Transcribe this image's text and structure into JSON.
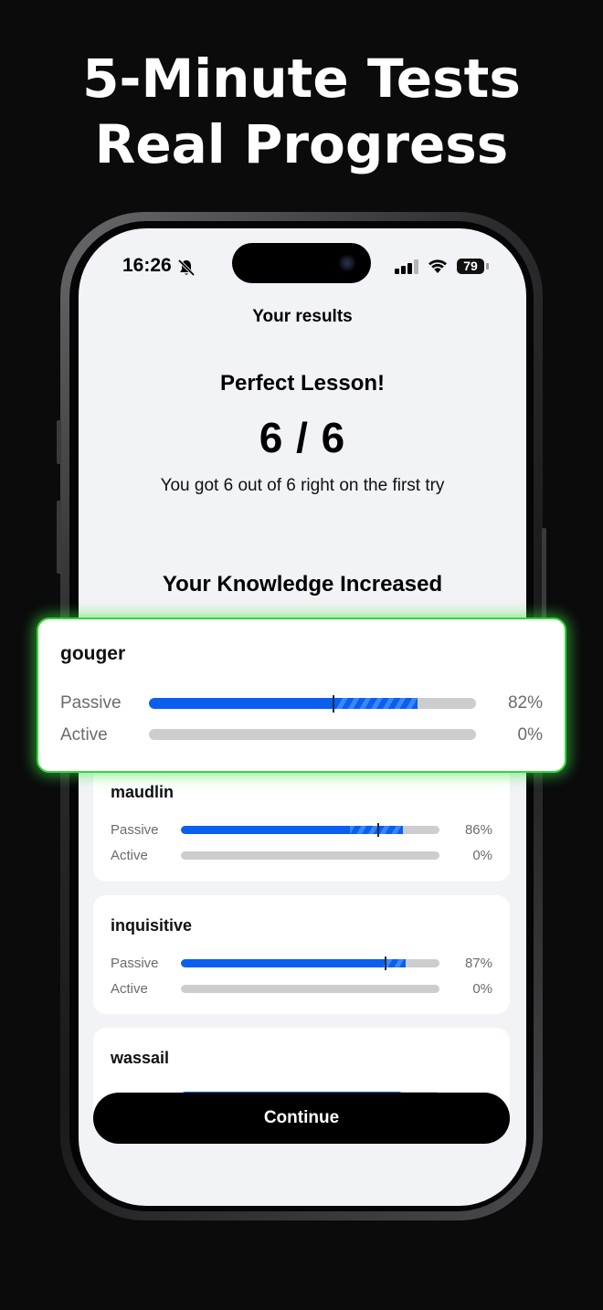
{
  "headline": {
    "line1": "5-Minute Tests",
    "line2": "Real Progress"
  },
  "status_bar": {
    "time": "16:26",
    "battery": "79"
  },
  "results": {
    "title": "Your results",
    "heading": "Perfect Lesson!",
    "score": "6 / 6",
    "subtitle": "You got 6 out of 6 right on the first try",
    "section_title": "Your Knowledge Increased"
  },
  "highlight_card": {
    "word": "gouger",
    "passive_label": "Passive",
    "passive_pct": "82%",
    "passive_value": 0.82,
    "active_label": "Active",
    "active_pct": "0%",
    "active_value": 0.0
  },
  "cards": [
    {
      "word": "maudlin",
      "passive_label": "Passive",
      "passive_pct": "86%",
      "passive_value": 0.86,
      "active_label": "Active",
      "active_pct": "0%",
      "active_value": 0.0
    },
    {
      "word": "inquisitive",
      "passive_label": "Passive",
      "passive_pct": "87%",
      "passive_value": 0.87,
      "active_label": "Active",
      "active_pct": "0%",
      "active_value": 0.0
    },
    {
      "word": "wassail"
    }
  ],
  "continue_button": {
    "label": "Continue"
  },
  "colors": {
    "accent": "#0a5ff0",
    "highlight": "#35d43b",
    "track": "#cdcdcf"
  }
}
